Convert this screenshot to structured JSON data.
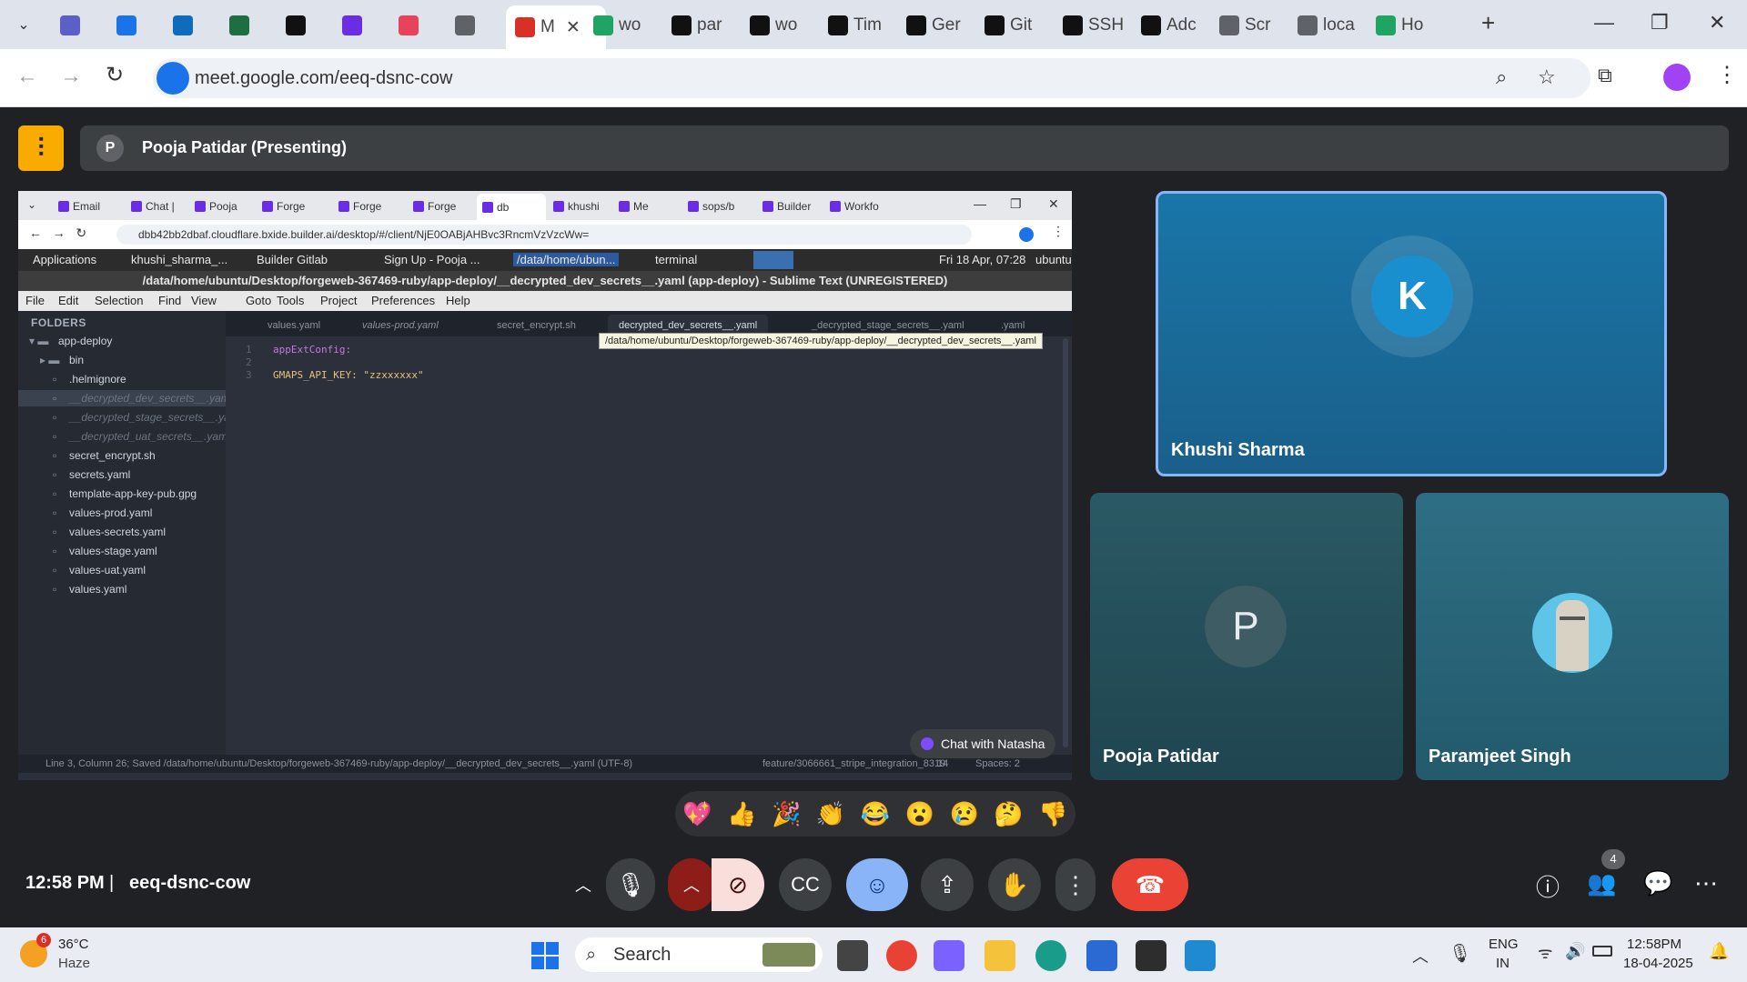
{
  "browser": {
    "tabs": [
      {
        "label": "",
        "icon": "teams-icon",
        "color": "#5b5fc7"
      },
      {
        "label": "",
        "icon": "power-icon",
        "color": "#1a73e8"
      },
      {
        "label": "",
        "icon": "outlook-icon",
        "color": "#0f6cbd"
      },
      {
        "label": "",
        "icon": "excel-icon",
        "color": "#1d6f42"
      },
      {
        "label": "",
        "icon": "b-icon",
        "color": "#111111"
      },
      {
        "label": "",
        "icon": "b-purple-icon",
        "color": "#6b2de3"
      },
      {
        "label": "",
        "icon": "figma-icon",
        "color": "#e8435a"
      },
      {
        "label": "",
        "icon": "globe-icon",
        "color": "#5f6368"
      },
      {
        "label": "M",
        "icon": "meet-record-icon",
        "color": "#d93025",
        "active": true
      },
      {
        "label": "wo",
        "icon": "drive-icon",
        "color": "#1fa463"
      },
      {
        "label": "par",
        "icon": "github-icon",
        "color": "#111111"
      },
      {
        "label": "wo",
        "icon": "github-icon",
        "color": "#111111"
      },
      {
        "label": "Tim",
        "icon": "openai-icon",
        "color": "#111111"
      },
      {
        "label": "Ger",
        "icon": "github-icon",
        "color": "#111111"
      },
      {
        "label": "Git",
        "icon": "openai-icon",
        "color": "#111111"
      },
      {
        "label": "SSH",
        "icon": "github-icon",
        "color": "#111111"
      },
      {
        "label": "Adc",
        "icon": "github-icon",
        "color": "#111111"
      },
      {
        "label": "Scr",
        "icon": "globe-icon",
        "color": "#5f6368"
      },
      {
        "label": "loca",
        "icon": "globe-icon",
        "color": "#5f6368"
      },
      {
        "label": "Ho",
        "icon": "drive-icon",
        "color": "#1fa463"
      }
    ],
    "url": "meet.google.com/eeq-dsnc-cow"
  },
  "meet": {
    "presenter_initial": "P",
    "presenter_label": "Pooja Patidar (Presenting)",
    "meeting_time": "12:58 PM",
    "meeting_code": "eeq-dsnc-cow",
    "participants_count": "4",
    "reactions": [
      "💖",
      "👍",
      "🎉",
      "👏",
      "😂",
      "😮",
      "😢",
      "🤔",
      "👎"
    ],
    "participants": [
      {
        "name": "Khushi Sharma",
        "initial": "K"
      },
      {
        "name": "Pooja Patidar",
        "initial": "P"
      },
      {
        "name": "Paramjeet Singh",
        "initial": ""
      }
    ],
    "chat_button": "Chat with Natasha"
  },
  "shared": {
    "tabs": [
      "Email",
      "Chat |",
      "Pooja",
      "Forge",
      "Forge",
      "Forge",
      "db",
      "khushi",
      "Me",
      "sops/b",
      "Builder",
      "Workfo"
    ],
    "url": "dbb42bb2dbaf.cloudflare.bxide.builder.ai/desktop/#/client/NjE0OABjAHBvc3RncmVzVzcWw=",
    "ubuntu": {
      "applications": "Applications",
      "items": [
        "khushi_sharma_...",
        "Builder Gitlab",
        "Sign Up - Pooja ...",
        "/data/home/ubun...",
        "terminal"
      ],
      "datetime": "Fri 18 Apr, 07:28",
      "user": "ubuntu"
    },
    "title": "/data/home/ubuntu/Desktop/forgeweb-367469-ruby/app-deploy/__decrypted_dev_secrets__.yaml (app-deploy) - Sublime Text (UNREGISTERED)",
    "menu": [
      "File",
      "Edit",
      "Selection",
      "Find",
      "View",
      "Goto",
      "Tools",
      "Project",
      "Preferences",
      "Help"
    ],
    "folders_label": "FOLDERS",
    "tree": [
      {
        "label": "app-deploy",
        "level": 0,
        "type": "folder"
      },
      {
        "label": "bin",
        "level": 1,
        "type": "folder"
      },
      {
        "label": ".helmignore",
        "level": 1,
        "type": "file"
      },
      {
        "label": "__decrypted_dev_secrets__.yaml",
        "level": 1,
        "type": "file",
        "dim": true,
        "selected": true
      },
      {
        "label": "__decrypted_stage_secrets__.yaml",
        "level": 1,
        "type": "file",
        "dim": true
      },
      {
        "label": "__decrypted_uat_secrets__.yaml",
        "level": 1,
        "type": "file",
        "dim": true
      },
      {
        "label": "secret_encrypt.sh",
        "level": 1,
        "type": "file"
      },
      {
        "label": "secrets.yaml",
        "level": 1,
        "type": "file"
      },
      {
        "label": "template-app-key-pub.gpg",
        "level": 1,
        "type": "file"
      },
      {
        "label": "values-prod.yaml",
        "level": 1,
        "type": "file"
      },
      {
        "label": "values-secrets.yaml",
        "level": 1,
        "type": "file"
      },
      {
        "label": "values-stage.yaml",
        "level": 1,
        "type": "file"
      },
      {
        "label": "values-uat.yaml",
        "level": 1,
        "type": "file"
      },
      {
        "label": "values.yaml",
        "level": 1,
        "type": "file"
      }
    ],
    "editor_tabs": [
      "values.yaml",
      "values-prod.yaml",
      "secret_encrypt.sh",
      "decrypted_dev_secrets__.yaml",
      "_decrypted_stage_secrets__.yaml",
      ".yaml"
    ],
    "tooltip": "/data/home/ubuntu/Desktop/forgeweb-367469-ruby/app-deploy/__decrypted_dev_secrets__.yaml",
    "code": [
      {
        "n": "1",
        "text": "appExtConfig:"
      },
      {
        "n": "2",
        "text": ""
      },
      {
        "n": "3",
        "text": "GMAPS_API_KEY: \"zzxxxxxx\""
      }
    ],
    "status_left": "Line 3, Column 26; Saved /data/home/ubuntu/Desktop/forgeweb-367469-ruby/app-deploy/__decrypted_dev_secrets__.yaml (UTF-8)",
    "status_branch": "feature/3066661_stripe_integration_8319",
    "status_count": "14",
    "status_spaces": "Spaces: 2"
  },
  "taskbar": {
    "weather_temp": "36°C",
    "weather_desc": "Haze",
    "weather_badge": "6",
    "search": "Search",
    "lang": "ENG",
    "lang2": "IN",
    "time": "12:58PM",
    "date": "18-04-2025"
  }
}
